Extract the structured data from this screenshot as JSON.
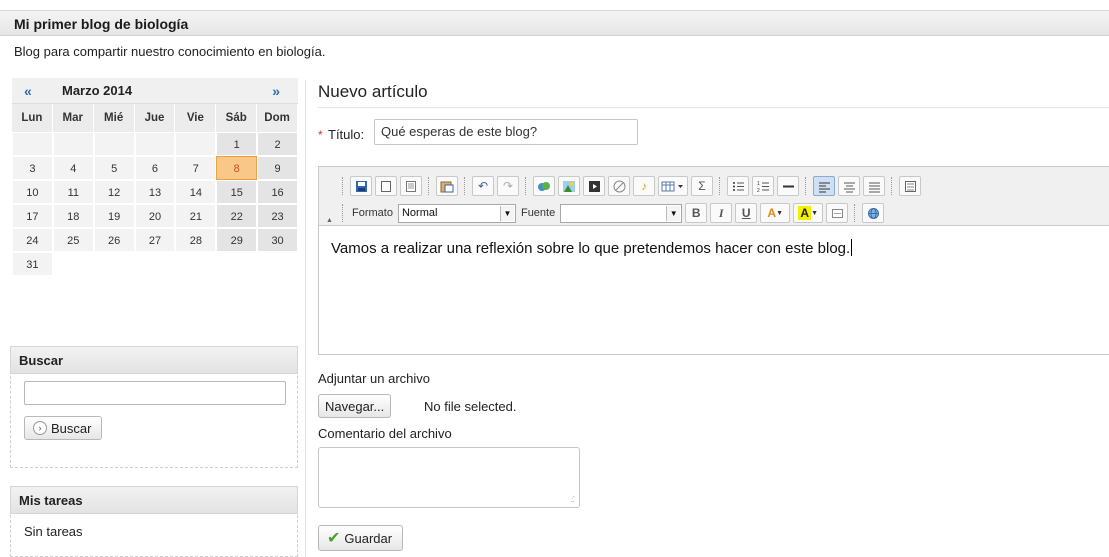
{
  "blog": {
    "title": "Mi primer blog de biología",
    "description": "Blog para compartir nuestro conocimiento en biología."
  },
  "calendar": {
    "prev": "«",
    "next": "»",
    "month": "Marzo 2014",
    "weekdays": [
      "Lun",
      "Mar",
      "Mié",
      "Jue",
      "Vie",
      "Sáb",
      "Dom"
    ],
    "weeks": [
      [
        "",
        "",
        "",
        "",
        "",
        "1",
        "2"
      ],
      [
        "3",
        "4",
        "5",
        "6",
        "7",
        "8",
        "9"
      ],
      [
        "10",
        "11",
        "12",
        "13",
        "14",
        "15",
        "16"
      ],
      [
        "17",
        "18",
        "19",
        "20",
        "21",
        "22",
        "23"
      ],
      [
        "24",
        "25",
        "26",
        "27",
        "28",
        "29",
        "30"
      ],
      [
        "31",
        "",
        "",
        "",
        "",
        "",
        ""
      ]
    ],
    "today": "8"
  },
  "search": {
    "title": "Buscar",
    "value": "",
    "button_label": "Buscar"
  },
  "tasks": {
    "title": "Mis tareas",
    "empty_text": "Sin tareas"
  },
  "article": {
    "heading": "Nuevo artículo",
    "required_mark": "*",
    "title_label": "Título:",
    "title_value": "Qué esperas de este blog?",
    "toolbar": {
      "format_label": "Formato",
      "format_value": "Normal",
      "font_label": "Fuente",
      "font_value": ""
    },
    "body": "Vamos a realizar una reflexión sobre lo que pretendemos hacer con este blog.",
    "attach_label": "Adjuntar un archivo",
    "browse_label": "Navegar...",
    "no_file_text": "No file selected.",
    "comment_label": "Comentario del archivo",
    "comment_value": "",
    "save_label": "Guardar"
  },
  "colors": {
    "today_bg": "#f9c888",
    "today_text": "#c7511d",
    "link": "#2a6fb0",
    "required": "#d9302a",
    "save_check": "#4aa02c"
  }
}
